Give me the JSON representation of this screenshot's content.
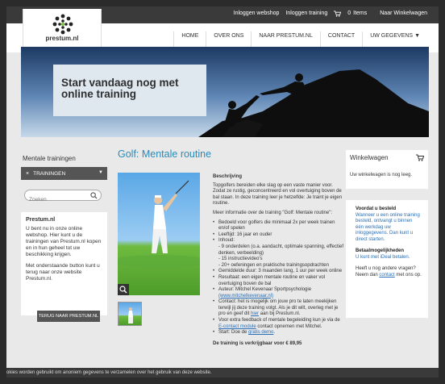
{
  "topbar": {
    "links": [
      "Inloggen webshop",
      "Inloggen training"
    ],
    "cart_count": "0",
    "cart_items_label": "Items",
    "cart_link": "Naar Winkelwagen"
  },
  "logo": {
    "text": "prestum.nl"
  },
  "nav": {
    "items": [
      "HOME",
      "OVER ONS",
      "NAAR PRESTUM.NL",
      "CONTACT",
      "UW GEGEVENS"
    ]
  },
  "banner": {
    "title": "Start vandaag nog met online training"
  },
  "left": {
    "heading": "Mentale trainingen",
    "dropdown_label": "TRAININGEN",
    "search_placeholder": "Zoeken",
    "info_title": "Prestum.nl",
    "info_p1": "U bent nu in onze online webshop. Hier kunt u de trainingen van Prestum.nl kopen en in hun geheel tot uw beschikking krijgen.",
    "info_p2": "Met onderstaande button kunt u terug naar onze website Prestum.nl.",
    "back_button": "TERUG NAAR PRESTUM.NL"
  },
  "product": {
    "title": "Golf: Mentale routine",
    "desc_heading": "Beschrijving",
    "intro": "Topgolfers bereiden elke slag op een vaste manier voor. Zodat ze rustig, geconcentreerd en vol overtuiging boven de bal staan. In deze training leer je hetzelfde: Je traint je eigen routine.",
    "more_info": "Meer informatie over de training \"Golf: Mentale routine\":",
    "b1": "Bedoeld voor golfers die minimaal 2x per week trainen en/of spelen",
    "b2": "Leeftijd: 16 jaar en ouder",
    "b3": "Inhoud:",
    "b3_s1": "- 9 onderdelen (o.a. aandacht, optimale spanning, effectief denken, verbeelding)",
    "b3_s2": "- 15 instructievideo's",
    "b3_s3": "- 20+ oefeningen en praktische trainingsopdrachten",
    "b4": "Gemiddelde duur: 3 maanden lang, 1 uur per week online",
    "b5": "Resultaat: een eigen mentale routine en vaker vol overtuiging boven de bal",
    "b6": "Auteur: Mitchel Kevenaar Sportpsychologie",
    "b6_link": "(www.mitchelkevenaar.nl)",
    "b7_pre": "Contact: het is mogelijk om jouw pro te laten meekijken terwijl jij deze training volgt. Als je dit wilt, overleg met je pro en geef dit",
    "b7_link": "hier",
    "b7_post": "aan bij Prestum.nl.",
    "b8_pre": "Voor extra feedback of mentale begeleiding kun je via de",
    "b8_link": "E-contact module",
    "b8_post": "contact opnemen met Mitchel.",
    "b9_pre": "Start: Doe de",
    "b9_link": "gratis demo",
    "b9_post": ".",
    "price": "De training is verkrijgbaar voor € 89,95"
  },
  "right": {
    "cart_heading": "Winkelwagen",
    "cart_empty": "Uw winkelwagen is nog leeg.",
    "h1": "Voordat u besteld",
    "p1": "Wanneer u een online training besteld, ontvangt u binnen één werkdag uw inloggegevens. Dan kunt u direct starten.",
    "h2": "Betaalmogelijkheden",
    "p2": "U kunt met iDeal betalen.",
    "p3_pre": "Heeft u nog andere vragen? Neem dan",
    "p3_link": "contact",
    "p3_post": "met ons op."
  },
  "cookie": {
    "text": "okies worden gebruikt om anoniem gegevens te verzamelen over het gebruik van deze website."
  },
  "colors": {
    "accent": "#2a8ab7",
    "dark": "#3a3a3a",
    "button": "#555555"
  }
}
